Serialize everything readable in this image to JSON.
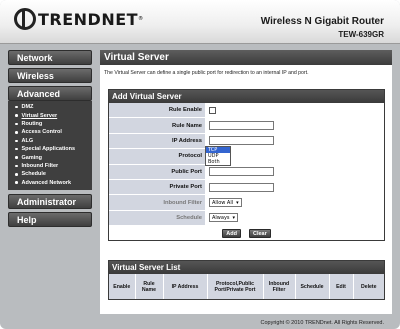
{
  "brand": {
    "logo_text": "TRENDNET",
    "registered": "®"
  },
  "header": {
    "product": "Wireless N Gigabit Router",
    "model": "TEW-639GR"
  },
  "sidebar": {
    "network": "Network",
    "wireless": "Wireless",
    "advanced": "Advanced",
    "advanced_items": [
      {
        "label": "DMZ"
      },
      {
        "label": "Virtual Server"
      },
      {
        "label": "Routing"
      },
      {
        "label": "Access Control"
      },
      {
        "label": "ALG"
      },
      {
        "label": "Special Applications"
      },
      {
        "label": "Gaming"
      },
      {
        "label": "Inbound Filter"
      },
      {
        "label": "Schedule"
      },
      {
        "label": "Advanced Network"
      }
    ],
    "administrator": "Administrator",
    "help": "Help"
  },
  "main": {
    "title": "Virtual Server",
    "description": "The Virtual Server can define a single public port for redirection to an internal IP and port."
  },
  "add_form": {
    "title": "Add Virtual Server",
    "rule_enable_label": "Rule Enable",
    "rule_name_label": "Rule Name",
    "ip_address_label": "IP Address",
    "protocol_label": "Protocol",
    "protocol_options": [
      "TCP",
      "UDP",
      "Both"
    ],
    "protocol_selected": "TCP",
    "public_port_label": "Public Port",
    "private_port_label": "Private Port",
    "inbound_filter_label": "Inbound Filter",
    "inbound_filter_value": "Allow All",
    "schedule_label": "Schedule",
    "schedule_value": "Always",
    "add_button": "Add",
    "clear_button": "Clear"
  },
  "list": {
    "title": "Virtual Server List",
    "columns": [
      "Enable",
      "Rule Name",
      "IP Address",
      "Protocol,Public Port/Private Port",
      "Inbound Filter",
      "Schedule",
      "Edit",
      "Delete"
    ]
  },
  "footer": {
    "copyright": "Copyright © 2010 TRENDnet. All Rights Reserved."
  }
}
